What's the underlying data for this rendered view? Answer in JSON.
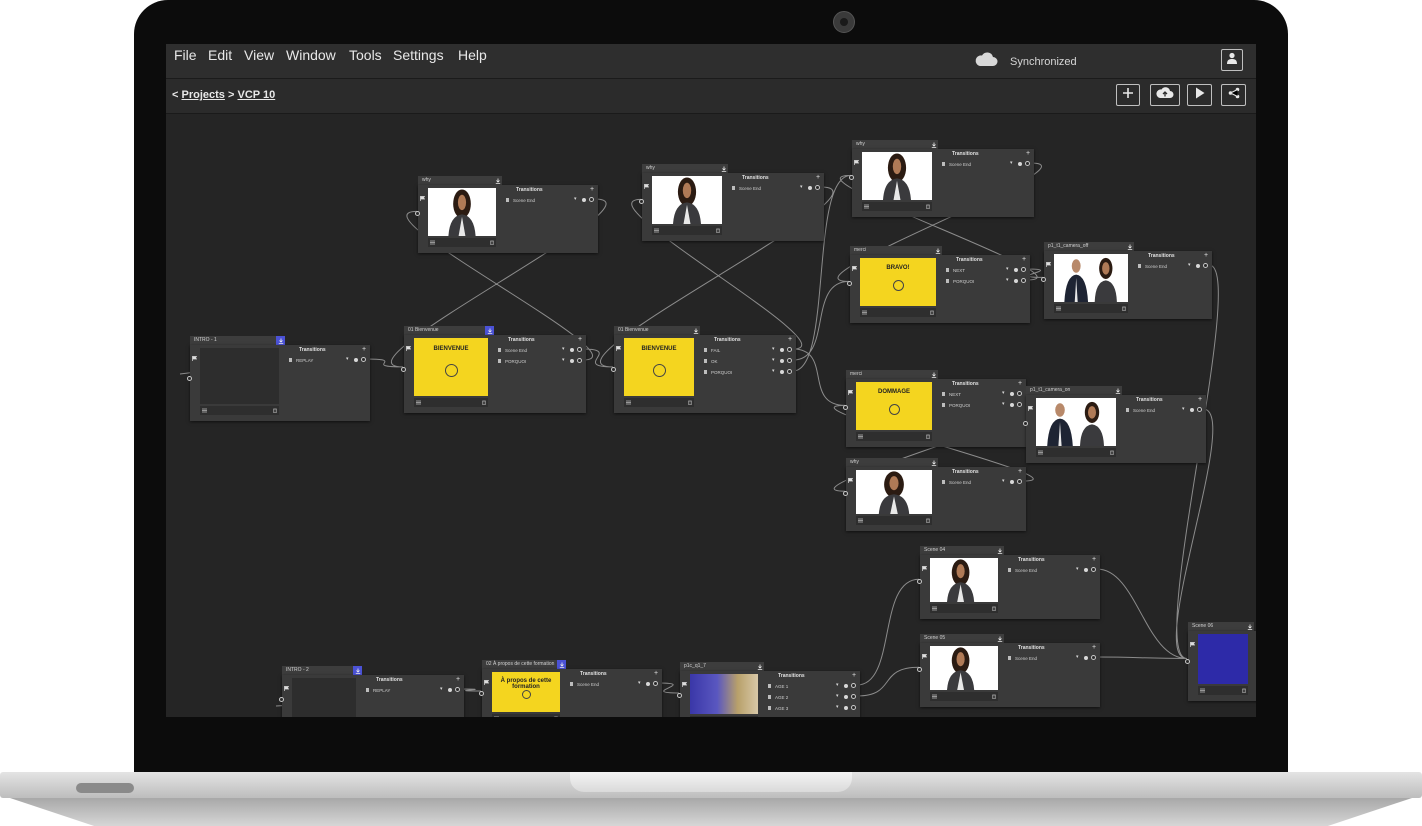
{
  "menu": [
    "File",
    "Edit",
    "View",
    "Window",
    "Tools",
    "Settings",
    "Help"
  ],
  "status": {
    "sync_label": "Synchronized"
  },
  "breadcrumb": {
    "back": "<",
    "projects": "Projects",
    "separator": ">",
    "current": "VCP 10"
  },
  "colors": {
    "background": "#232323",
    "node_tab_accent": "#4b52d6",
    "yellow_card": "#f4d51f",
    "blue_card": "#2d2aa8"
  },
  "icons": {
    "cloud": "cloud-icon",
    "user": "user-icon",
    "add": "plus-icon",
    "upload": "cloud-upload-icon",
    "play": "play-icon",
    "share": "share-icon"
  },
  "nodes": [
    {
      "title": "INTRO - 1",
      "transitions": "Transitions",
      "rows": [
        "REPLAY"
      ]
    },
    {
      "title": "why",
      "transitions": "Transitions",
      "rows": [
        "Scene End"
      ]
    },
    {
      "title": "01 Bienvenue",
      "transitions": "Transitions",
      "rows": [
        "Scene End",
        "PORQUOI"
      ],
      "card_title": "BIENVENUE"
    },
    {
      "title": "why",
      "transitions": "Transitions",
      "rows": [
        "Scene End"
      ]
    },
    {
      "title": "01 Bienvenue",
      "transitions": "Transitions",
      "rows": [
        "FAIL",
        "OK",
        "PORQUOI"
      ],
      "card_title": "BIENVENUE"
    },
    {
      "title": "why",
      "transitions": "Transitions",
      "rows": [
        "Scene End"
      ]
    },
    {
      "title": "merci",
      "transitions": "Transitions",
      "rows": [
        "NEXT",
        "PORQUOI"
      ],
      "card_title": "BRAVO!"
    },
    {
      "title": "p1_t1_camera_off",
      "transitions": "Transitions",
      "rows": [
        "Scene End"
      ]
    },
    {
      "title": "merci",
      "transitions": "Transitions",
      "rows": [
        "NEXT",
        "PORQUOI"
      ],
      "card_title": "DOMMAGE"
    },
    {
      "title": "p1_t1_camera_on",
      "transitions": "Transitions",
      "rows": [
        "Scene End"
      ]
    },
    {
      "title": "why",
      "transitions": "Transitions",
      "rows": [
        "Scene End"
      ]
    },
    {
      "title": "Scene 04",
      "transitions": "Transitions",
      "rows": [
        "Scene End"
      ]
    },
    {
      "title": "Scene 05",
      "transitions": "Transitions",
      "rows": [
        "Scene End"
      ]
    },
    {
      "title": "Scene 06",
      "transitions": "",
      "rows": []
    },
    {
      "title": "INTRO - 2",
      "transitions": "Transitions",
      "rows": [
        "REPLAY"
      ]
    },
    {
      "title": "02 À propos de cette formation",
      "transitions": "Transitions",
      "rows": [
        "Scene End"
      ],
      "card_title": "À propos de cette formation"
    },
    {
      "title": "p1c_q1_7",
      "transitions": "Transitions",
      "rows": [
        "AGE 1",
        "AGE 2",
        "AGE 3"
      ]
    }
  ]
}
